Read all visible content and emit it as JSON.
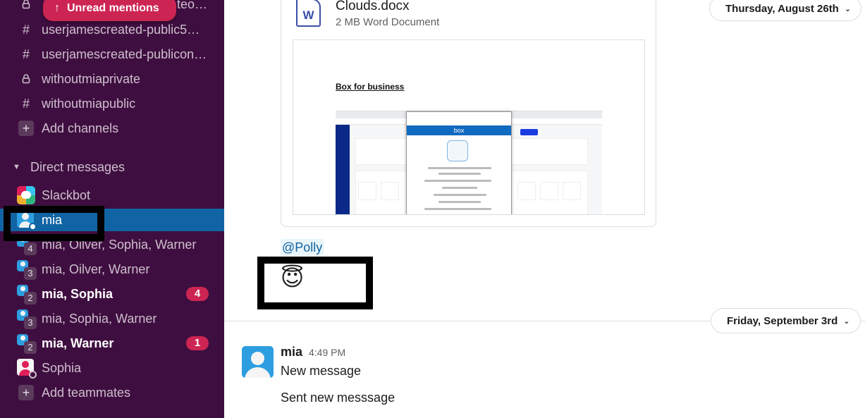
{
  "sidebar": {
    "unread_mentions": {
      "label": "Unread mentions",
      "icon": "arrow-up-icon"
    },
    "channels": [
      {
        "type": "private",
        "label": "userjamescreated-privateteo…",
        "visible_fragment": "teo…"
      },
      {
        "type": "public",
        "label": "userjamescreated-public5…"
      },
      {
        "type": "public",
        "label": "userjamescreated-publicon…"
      },
      {
        "type": "private",
        "label": "withoutmiaprivate"
      },
      {
        "type": "public",
        "label": "withoutmiapublic"
      }
    ],
    "add_channels": "Add channels",
    "direct_messages_header": "Direct messages",
    "direct_messages": [
      {
        "label": "Slackbot",
        "avatar": "slackbot",
        "bold": false
      },
      {
        "label": "mia",
        "avatar": "person",
        "active": true,
        "status": "online"
      },
      {
        "label": "mia, Oilver, Sophia, Warner",
        "avatar": "group",
        "count": "4"
      },
      {
        "label": "mia, Oilver, Warner",
        "avatar": "group",
        "count": "3"
      },
      {
        "label": "mia, Sophia",
        "avatar": "group",
        "count": "2",
        "bold": true,
        "badge": "4"
      },
      {
        "label": "mia, Sophia, Warner",
        "avatar": "group",
        "count": "3"
      },
      {
        "label": "mia, Warner",
        "avatar": "group",
        "count": "2",
        "bold": true,
        "badge": "1"
      },
      {
        "label": "Sophia",
        "avatar": "person-pink",
        "status": "away"
      }
    ],
    "add_teammates": "Add teammates",
    "colors": {
      "background": "#3f0e40",
      "active": "#1164a3",
      "badge": "#cd2553"
    }
  },
  "main": {
    "file": {
      "name": "Clouds.docx",
      "meta": "2 MB Word Document",
      "icon_letter": "W",
      "preview": {
        "title": "Box for business",
        "popup_brand": "box"
      }
    },
    "mention": "@Polly",
    "emoji": "😇",
    "date_dividers": [
      {
        "label": "Thursday, August 26th"
      },
      {
        "label": "Friday, September 3rd"
      }
    ],
    "message": {
      "author": "mia",
      "time": "4:49 PM",
      "lines": [
        "New message",
        "Sent new messsage"
      ]
    }
  }
}
